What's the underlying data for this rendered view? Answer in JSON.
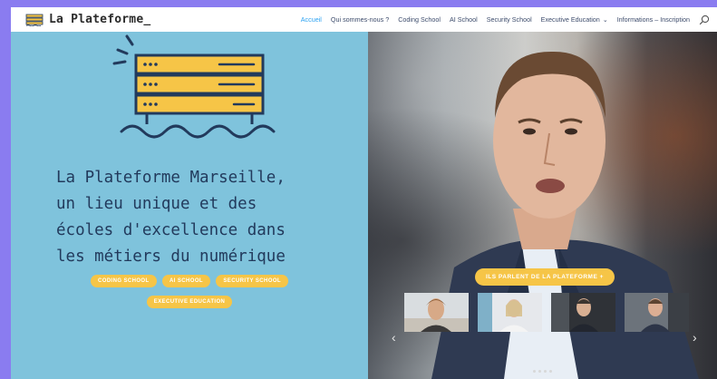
{
  "header": {
    "logo_text": "La Plateforme_",
    "nav": [
      {
        "label": "Accueil",
        "active": true
      },
      {
        "label": "Qui sommes-nous ?",
        "active": false
      },
      {
        "label": "Coding School",
        "active": false
      },
      {
        "label": "AI School",
        "active": false
      },
      {
        "label": "Security School",
        "active": false
      },
      {
        "label": "Executive Education",
        "active": false,
        "dropdown": true
      },
      {
        "label": "Informations – Inscription",
        "active": false
      }
    ],
    "search_icon": "search-icon"
  },
  "hero": {
    "headline": "La Plateforme Marseille,\nun lieu unique et des\nécoles d'excellence dans\nles métiers du numérique",
    "pills_row1": [
      "CODING SCHOOL",
      "AI SCHOOL",
      "SECURITY SCHOOL"
    ],
    "pills_row2": [
      "EXECUTIVE EDUCATION"
    ]
  },
  "video": {
    "cta_label": "ILS PARLENT DE LA PLATEFORME +",
    "thumbnail_count": 4,
    "carousel_dots": 4
  },
  "colors": {
    "accent_blue": "#2ea3f2",
    "hero_bg": "#7fc3dc",
    "navy": "#223a5c",
    "yellow": "#f6c547",
    "page_border": "#8a7cf0"
  }
}
